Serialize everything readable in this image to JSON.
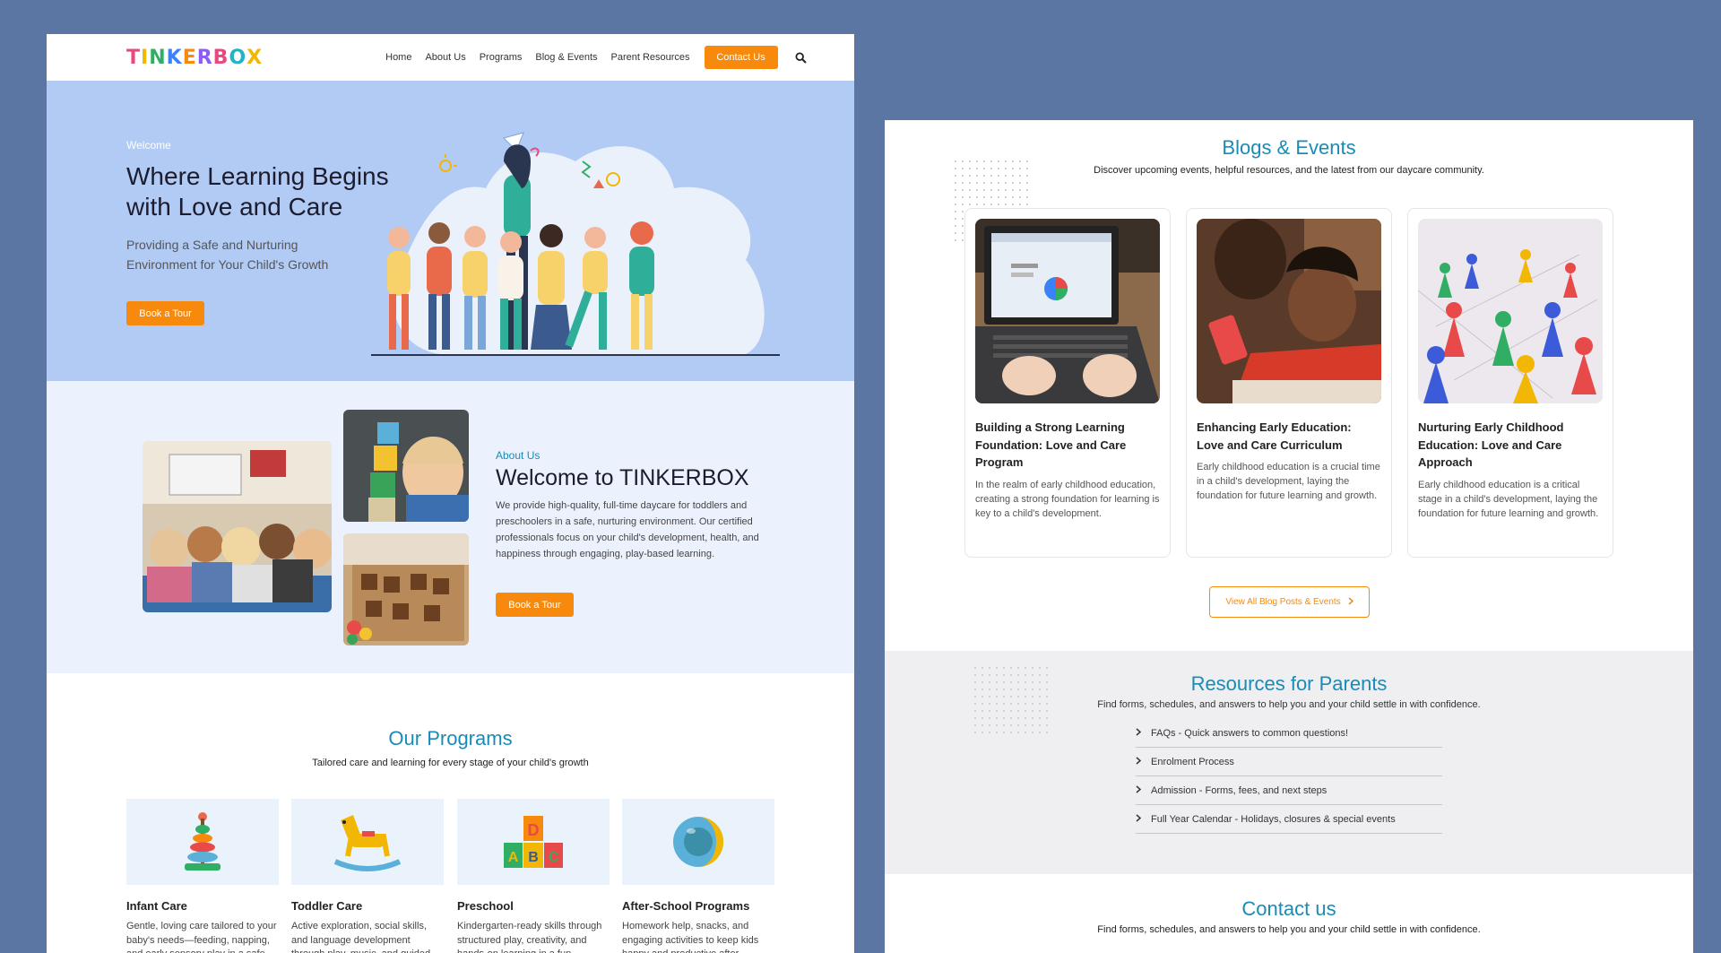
{
  "nav": {
    "logo_letters": [
      "T",
      "I",
      "N",
      "K",
      "E",
      "R",
      "B",
      "O",
      "X"
    ],
    "logo_colors": [
      "#e84a7f",
      "#f2b705",
      "#2fae64",
      "#3b82f6",
      "#f7890c",
      "#8b5cf6",
      "#e84a7f",
      "#20b3c9",
      "#f2b705"
    ],
    "items": [
      "Home",
      "About Us",
      "Programs",
      "Blog & Events",
      "Parent Resources"
    ],
    "contact_label": "Contact Us",
    "search_icon": "search-icon"
  },
  "hero": {
    "eyebrow": "Welcome",
    "title": "Where Learning Begins with Love and Care",
    "subtitle": "Providing a Safe and Nurturing Environment for Your Child's Growth",
    "cta": "Book a Tour"
  },
  "about": {
    "eyebrow": "About Us",
    "title": "Welcome to TINKERBOX",
    "body": "We provide high-quality, full-time daycare for toddlers and preschoolers in a safe, nurturing environment. Our certified professionals focus on your child's development, health, and happiness through engaging, play-based learning.",
    "cta": "Book a Tour"
  },
  "programs": {
    "title": "Our Programs",
    "tagline": "Tailored care and learning for every stage of your child's growth",
    "items": [
      {
        "title": "Infant Care",
        "desc": "Gentle, loving care tailored to your baby's needs—feeding, napping, and early sensory play in a safe, nurturing environment.",
        "icon": "stacking-rings-icon"
      },
      {
        "title": "Toddler Care",
        "desc": "Active exploration, social skills, and language development through play, music, and guided activities.",
        "icon": "rocking-horse-icon"
      },
      {
        "title": "Preschool",
        "desc": "Kindergarten-ready skills through structured play, creativity, and hands-on learning in a fun, supportive setting.",
        "icon": "abc-blocks-icon"
      },
      {
        "title": "After-School Programs",
        "desc": "Homework help, snacks, and engaging activities to keep kids happy and productive after school.",
        "icon": "ball-icon"
      }
    ]
  },
  "blogs": {
    "title": "Blogs & Events",
    "subtitle": "Discover upcoming events, helpful resources, and the latest from our daycare community.",
    "cards": [
      {
        "title": "Building a Strong Learning Foundation: Love and Care Program",
        "desc": "In the realm of early childhood education, creating a strong foundation for learning is key to a child's development."
      },
      {
        "title": "Enhancing Early Education: Love and Care Curriculum",
        "desc": "Early childhood education is a crucial time in a child's development, laying the foundation for future learning and growth."
      },
      {
        "title": "Nurturing Early Childhood Education: Love and Care Approach",
        "desc": "Early childhood education is a critical stage in a child's development, laying the foundation for future learning and growth."
      }
    ],
    "view_all": "View All Blog Posts & Events"
  },
  "resources": {
    "title": "Resources for Parents",
    "subtitle": "Find forms, schedules, and answers to help you and your child settle in with confidence.",
    "items": [
      "FAQs - Quick answers to common questions!",
      "Enrolment Process",
      "Admission - Forms, fees, and next steps",
      "Full Year Calendar - Holidays, closures & special events"
    ]
  },
  "contact": {
    "title": "Contact us",
    "subtitle": "Find forms, schedules, and answers to help you and your child settle in with confidence."
  },
  "colors": {
    "accent": "#f7890c",
    "heading": "#1a8bb6",
    "hero_bg": "#b1cbf5",
    "about_bg": "#ebf2fe",
    "page_bg": "#5b76a3"
  }
}
